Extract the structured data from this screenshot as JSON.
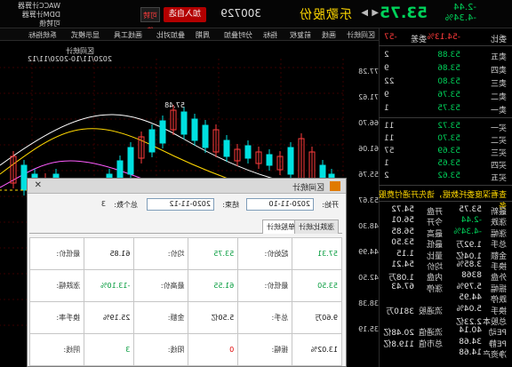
{
  "header": {
    "stock_name": "乐歌股份",
    "stock_code": "300729",
    "add_button": "加入自选",
    "convertible": "可转债",
    "price": "53.75",
    "change": "-2.44",
    "change_pct": "-4.34%",
    "prev": "◀",
    "next": "▶",
    "right_top": [
      "WACC计算器",
      "DDM计算器",
      "可转债"
    ]
  },
  "order_book": {
    "committee": {
      "label": "委比",
      "value": "-54.13%",
      "diff_label": "委差",
      "diff": "-57"
    },
    "asks": [
      {
        "label": "卖五",
        "price": "53.88",
        "vol": "2"
      },
      {
        "label": "卖四",
        "price": "53.86",
        "vol": "9"
      },
      {
        "label": "卖三",
        "price": "53.80",
        "vol": "22"
      },
      {
        "label": "卖二",
        "price": "53.76",
        "vol": "9"
      },
      {
        "label": "卖一",
        "price": "53.75",
        "vol": "1"
      }
    ],
    "bids": [
      {
        "label": "买一",
        "price": "53.72",
        "vol": "11"
      },
      {
        "label": "买二",
        "price": "53.70",
        "vol": "11"
      },
      {
        "label": "买三",
        "price": "53.69",
        "vol": "57"
      },
      {
        "label": "买四",
        "price": "53.65",
        "vol": "1"
      },
      {
        "label": "买五",
        "price": "53.62",
        "vol": "2"
      }
    ],
    "notice": "查看深度委托数据，请先开通付费服务",
    "stats": [
      {
        "label": "最新",
        "value": "53.75",
        "label2": "开盘",
        "value2": "54.72"
      },
      {
        "label": "涨跌",
        "value": "-2.44",
        "label2": "今开",
        "value2": "56.01"
      },
      {
        "label": "涨幅",
        "value": "-4.34%",
        "label2": "最高",
        "value2": "56.85"
      },
      {
        "label": "总手",
        "value": "1.92万",
        "label2": "最低",
        "value2": "53.50"
      },
      {
        "label": "金额",
        "value": "1.04亿",
        "label2": "量比",
        "value2": "1.15"
      },
      {
        "label": "换手",
        "value": "3.85%",
        "label2": "均价",
        "value2": "54.21"
      },
      {
        "label": "外盘",
        "value": "8368",
        "label2": "内盘",
        "value2": "1.08万"
      },
      {
        "label": "振幅",
        "value": "5.79%",
        "label2": "涨停",
        "value2": "67.43"
      },
      {
        "label": "跌停",
        "value": "44.95",
        "label2": "",
        "value2": ""
      },
      {
        "label": "换手",
        "value": "5.04%",
        "label2": "流通股",
        "value2": "3810万"
      },
      {
        "label": "总股本",
        "value": "2.23亿",
        "label2": "",
        "value2": ""
      },
      {
        "label": "PE动",
        "value": "40.14",
        "label2": "流通值",
        "value2": "20.48亿"
      },
      {
        "label": "PE静",
        "value": "34.68",
        "label2": "总市值",
        "value2": "119.8亿"
      },
      {
        "label": "净资产",
        "value": "14.68",
        "label2": "",
        "value2": ""
      }
    ]
  },
  "chart": {
    "tabs": [
      "区间统计",
      "画线",
      "前复权",
      "指标",
      "分时叠加",
      "周期",
      "叠加对比",
      "画线工具",
      "显示模式",
      "系统指标"
    ],
    "title_left": "区间统计",
    "date_range": "2020/11/10-2020/11/12",
    "peak_label": "57.48",
    "y_ticks": [
      "77.28",
      "71.62",
      "66.70",
      "61.06",
      "55.76",
      "53.67",
      "48.30",
      "44.99",
      "42.50",
      "38.38",
      "35.19"
    ]
  },
  "dialog": {
    "title": "区间统计",
    "close": "✕",
    "start_label": "开始:",
    "start_value": "2020-11-10",
    "end_label": "结束:",
    "end_value": "2020-11-12",
    "total_label": "总个数:",
    "total_value": "3",
    "tabs": [
      "单股统计",
      "涨跌比统计"
    ],
    "rows": [
      [
        {
          "k": "起始价:",
          "v": "57.31",
          "c": "v-green"
        },
        {
          "k": "均价:",
          "v": "53.75",
          "c": "v-green"
        },
        {
          "k": "最低价:",
          "v": "61.85",
          "c": "v-black"
        }
      ],
      [
        {
          "k": "最低价:",
          "v": "53.50",
          "c": "v-green"
        },
        {
          "k": "最高价:",
          "v": "61.55",
          "c": "v-green"
        },
        {
          "k": "涨跌幅:",
          "v": "-13.10%",
          "c": "v-green"
        }
      ],
      [
        {
          "k": "总手:",
          "v": "9.60万",
          "c": "v-black"
        },
        {
          "k": "金额:",
          "v": "5.50亿",
          "c": "v-black"
        },
        {
          "k": "换手率:",
          "v": "25.19%",
          "c": "v-black"
        }
      ],
      [
        {
          "k": "振幅:",
          "v": "13.02%",
          "c": "v-black"
        },
        {
          "k": "阳线:",
          "v": "0",
          "c": "v-red"
        },
        {
          "k": "阴线:",
          "v": "3",
          "c": "v-green"
        }
      ]
    ]
  }
}
